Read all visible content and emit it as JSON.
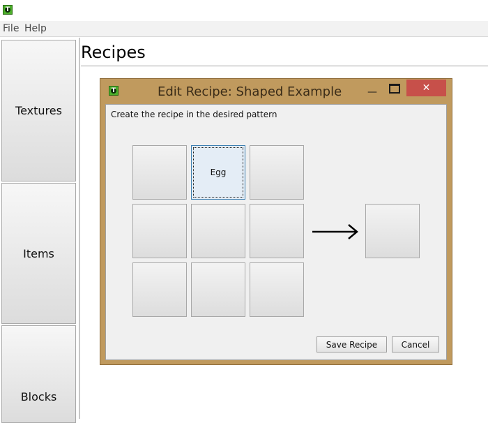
{
  "window": {
    "icon_letter": "T"
  },
  "menubar": {
    "items": [
      "File",
      "Help"
    ]
  },
  "sidebar": {
    "items": [
      {
        "label": "Textures"
      },
      {
        "label": "Items"
      },
      {
        "label": "Blocks"
      }
    ]
  },
  "main": {
    "title": "Recipes"
  },
  "dialog": {
    "icon_letter": "T",
    "title": "Edit Recipe: Shaped Example",
    "close_glyph": "✕",
    "minimize_glyph": "—",
    "instruction": "Create the recipe in the desired pattern",
    "grid": [
      [
        "",
        "Egg",
        ""
      ],
      [
        "",
        "",
        ""
      ],
      [
        "",
        "",
        ""
      ]
    ],
    "result": "",
    "save_label": "Save Recipe",
    "cancel_label": "Cancel",
    "frame_color": "#c09a5e",
    "close_color": "#c7504a"
  }
}
